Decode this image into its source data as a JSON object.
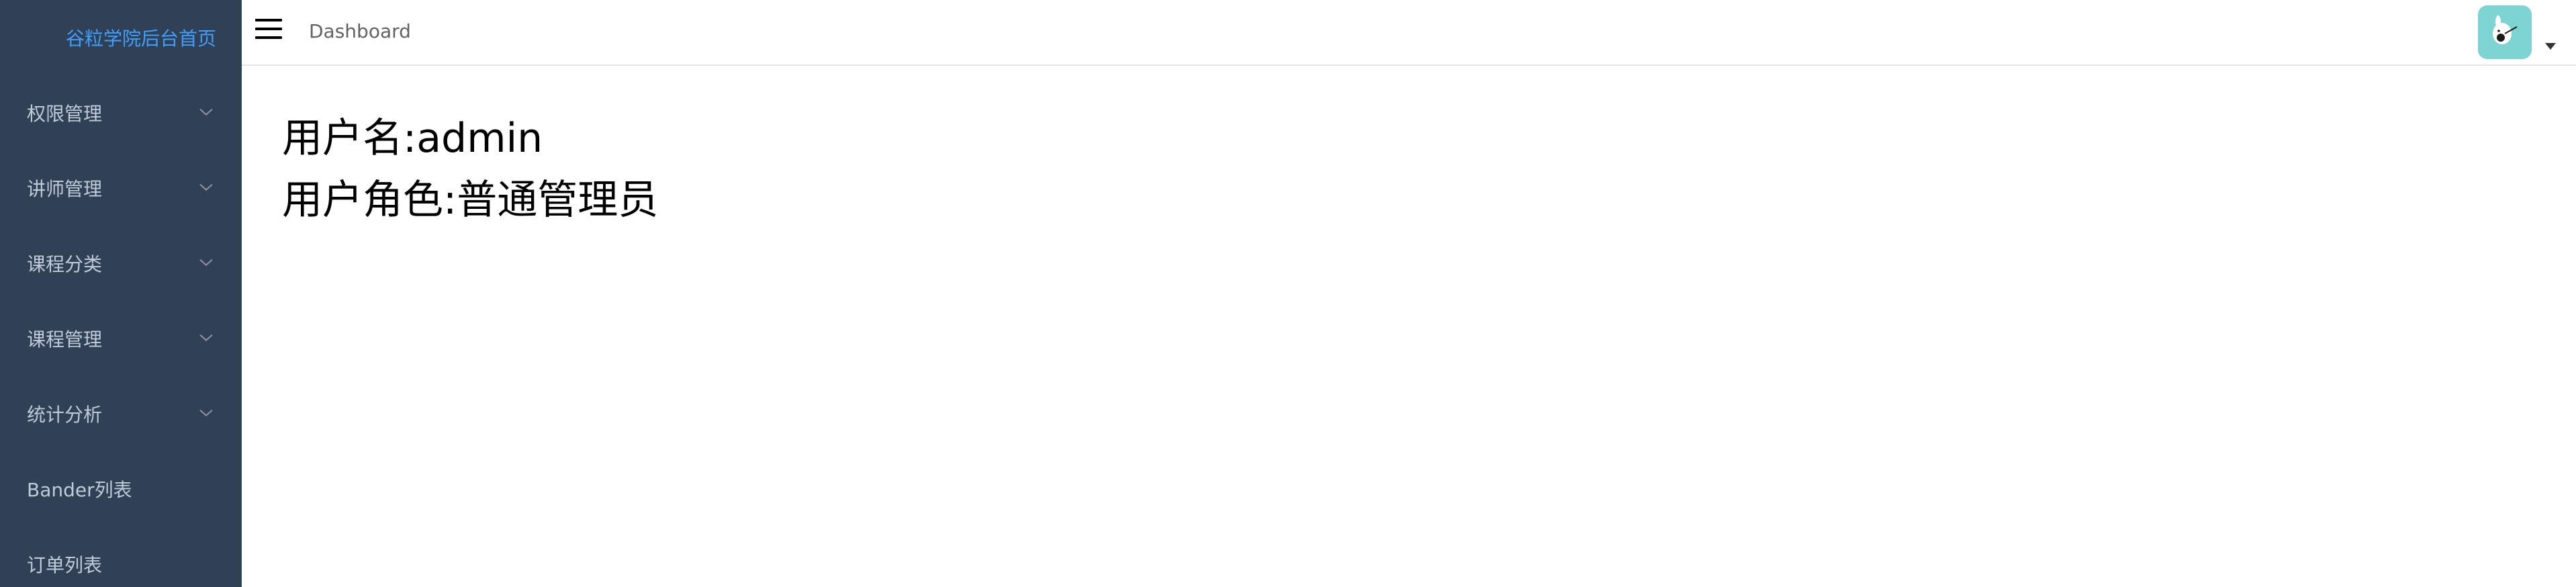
{
  "sidebar": {
    "logo_text": "谷粒学院后台首页",
    "items": [
      {
        "label": "权限管理",
        "has_children": true
      },
      {
        "label": "讲师管理",
        "has_children": true
      },
      {
        "label": "课程分类",
        "has_children": true
      },
      {
        "label": "课程管理",
        "has_children": true
      },
      {
        "label": "统计分析",
        "has_children": true
      },
      {
        "label": "Bander列表",
        "has_children": false
      },
      {
        "label": "订单列表",
        "has_children": false
      }
    ]
  },
  "navbar": {
    "breadcrumb": "Dashboard",
    "hamburger_icon": "hamburger-icon",
    "avatar_icon": "avatar-icon",
    "dropdown_icon": "caret-down-icon"
  },
  "main": {
    "username_line": "用户名:admin",
    "role_line": "用户角色:普通管理员"
  },
  "colors": {
    "sidebar_bg": "#304156",
    "sidebar_text": "#bfcbd9",
    "logo_text": "#409eff",
    "avatar_bg": "#7ed3d3"
  }
}
